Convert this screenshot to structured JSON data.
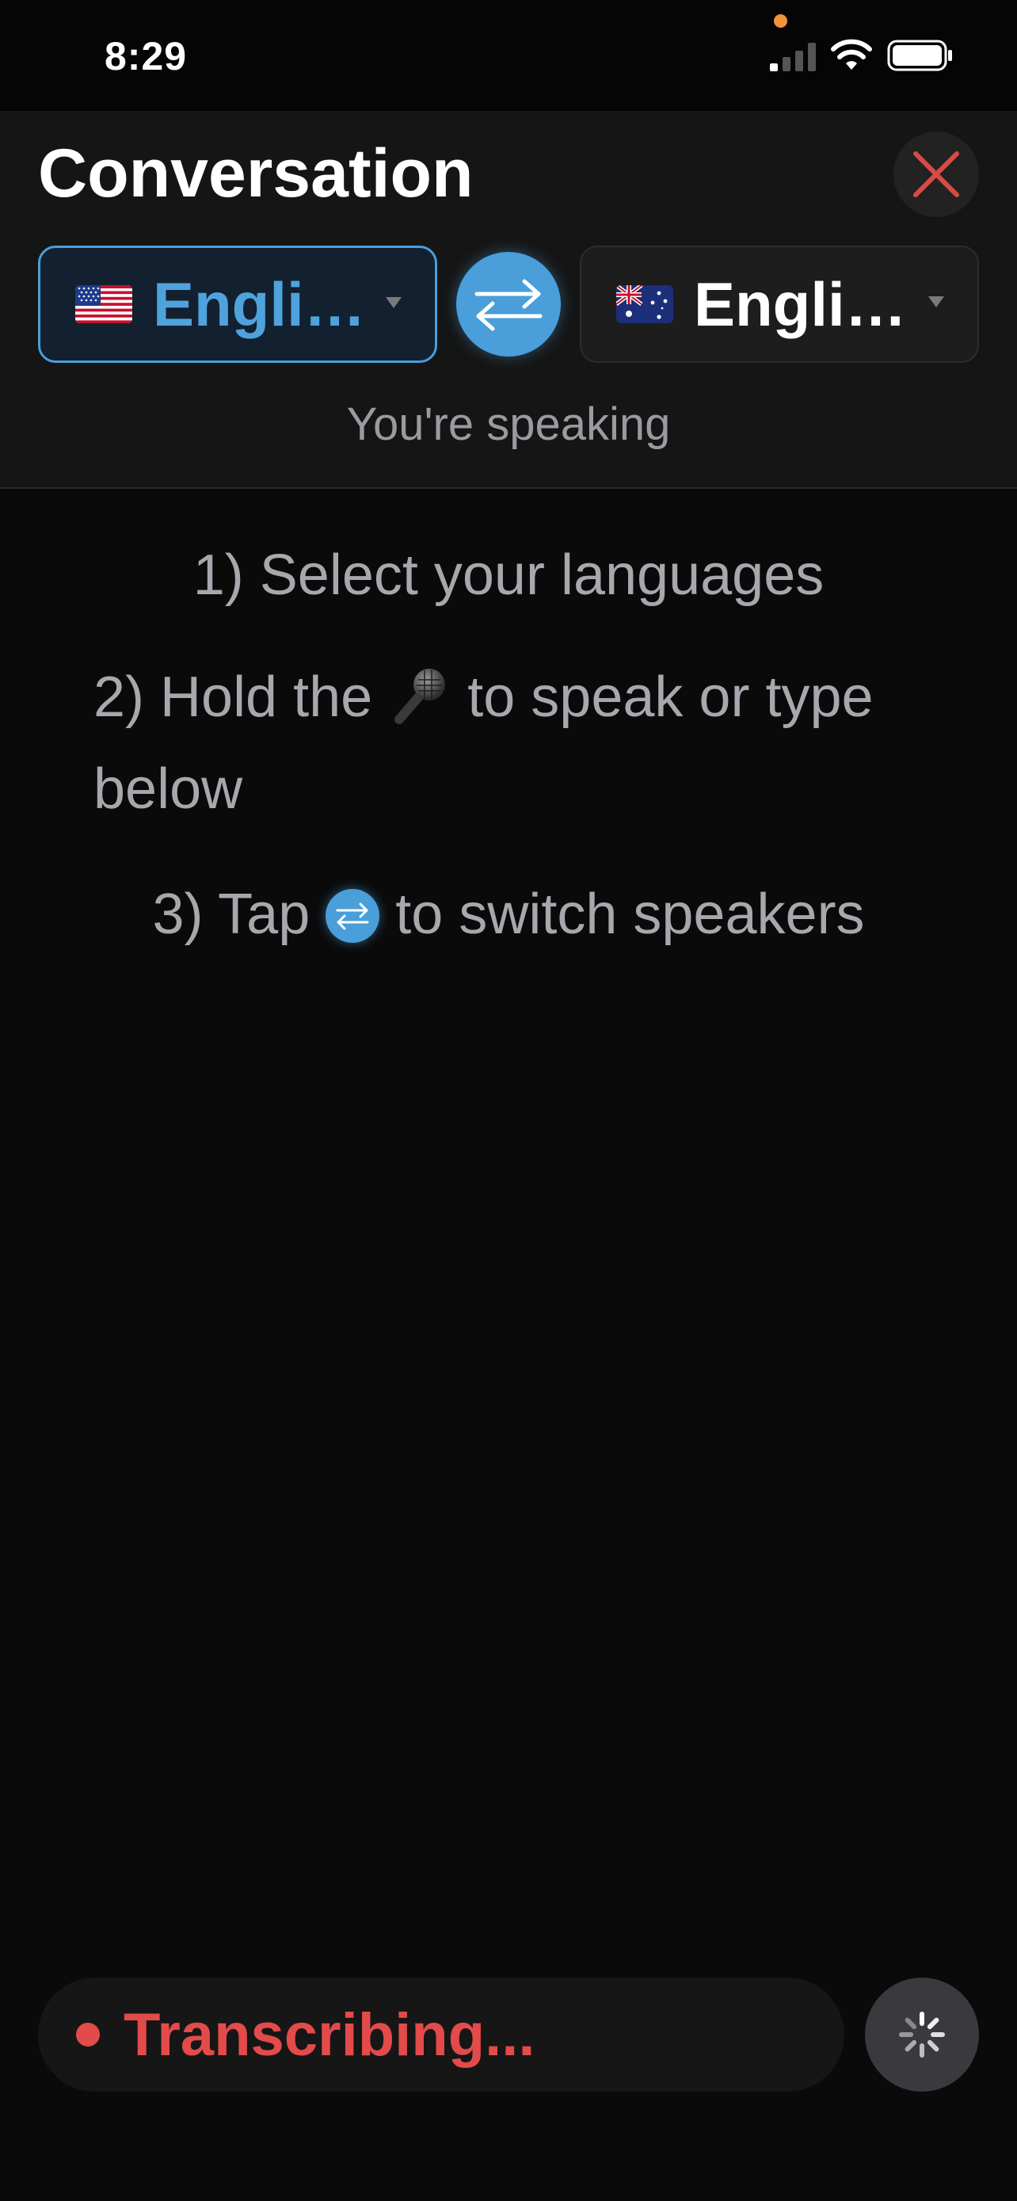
{
  "status_bar": {
    "time": "8:29",
    "icons": [
      "signal-icon",
      "wifi-icon",
      "battery-icon"
    ],
    "privacy_indicator_color": "#f2933a"
  },
  "header": {
    "title": "Conversation",
    "close_icon": "close-icon",
    "close_color": "#d94a45",
    "source_language": {
      "flag": "us-flag-icon",
      "label": "Engli…",
      "active": true
    },
    "target_language": {
      "flag": "au-flag-icon",
      "label": "Engli…",
      "active": false
    },
    "swap_icon": "swap-arrows-icon",
    "speaker_status": "You're speaking"
  },
  "instructions": {
    "step1": "1) Select your languages",
    "step2_prefix": "2) Hold the",
    "step2_suffix": "to speak or type below",
    "step3_prefix": "3) Tap",
    "step3_suffix": "to switch speakers"
  },
  "footer": {
    "transcribe_label": "Transcribing...",
    "loading_icon": "spinner-icon"
  },
  "colors": {
    "accent": "#4a9ed9",
    "recording": "#e24b4a",
    "background": "#0a0a0a",
    "header": "#151515"
  }
}
